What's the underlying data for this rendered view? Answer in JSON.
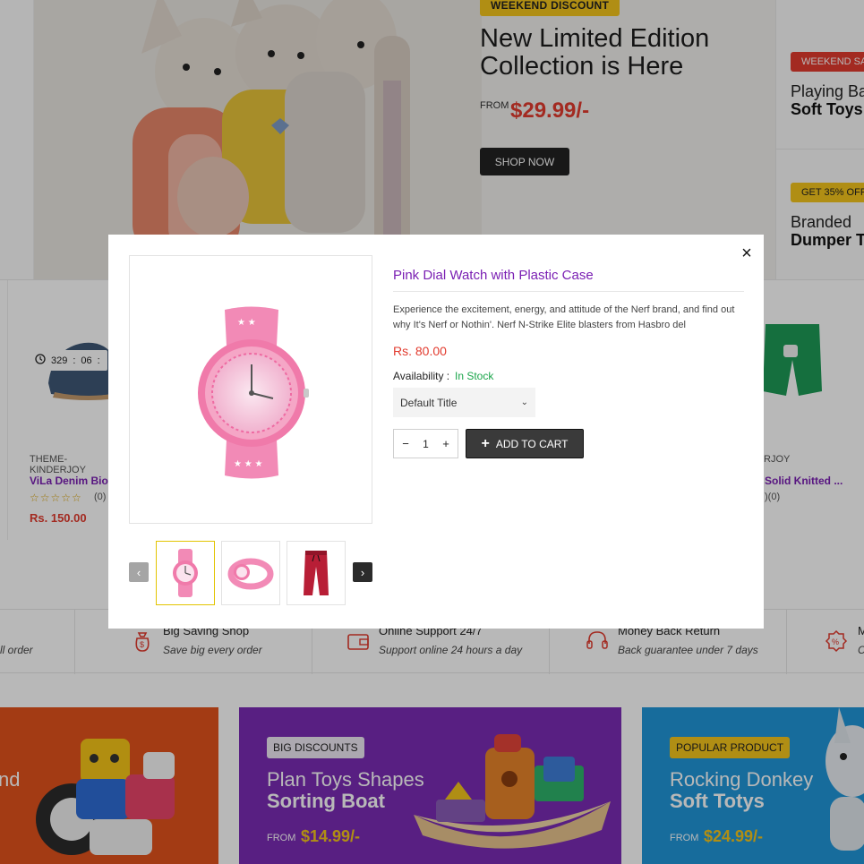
{
  "hero": {
    "badge": "WEEKEND DISCOUNT",
    "title": "New Limited Edition Collection is Here",
    "from_label": "FROM",
    "price": "$29.99/-",
    "button": "SHOP NOW"
  },
  "side_banners": [
    {
      "badge": "WEEKEND SA",
      "line1": "Playing Ba",
      "line2": "Soft Toys"
    },
    {
      "badge": "GET 35% OFF",
      "line1": "Branded",
      "line2": "Dumper Tr"
    }
  ],
  "products": {
    "left": {
      "timer": [
        "329",
        ":",
        "06",
        ":"
      ],
      "vendor": "THEME-KINDERJOY",
      "title": "ViLa Denim Bio Co",
      "stars": "☆☆☆☆☆",
      "count": "(0)",
      "price": "Rs. 150.00"
    },
    "right": {
      "vendor": "RJOY",
      "title": "Solid Knitted ...",
      "count": ")(0)"
    }
  },
  "features": [
    {
      "title": "",
      "subtitle": "ll order"
    },
    {
      "title": "Big Saving Shop",
      "subtitle": "Save big every order"
    },
    {
      "title": "Online Support 24/7",
      "subtitle": "Support online 24 hours a day"
    },
    {
      "title": "Money Back Return",
      "subtitle": "Back guarantee under 7 days"
    },
    {
      "title": "M",
      "subtitle": "C"
    }
  ],
  "promos": [
    {
      "badge": "",
      "line1": "nd",
      "line2": "",
      "from_label": "",
      "price": ""
    },
    {
      "badge": "BIG DISCOUNTS",
      "line1": "Plan Toys Shapes",
      "line2": "Sorting Boat",
      "from_label": "FROM",
      "price": "$14.99/-"
    },
    {
      "badge": "POPULAR PRODUCT",
      "line1": "Rocking Donkey",
      "line2": "Soft Totys",
      "from_label": "FROM",
      "price": "$24.99/-"
    }
  ],
  "modal": {
    "close": "×",
    "title": "Pink Dial Watch with Plastic Case",
    "description": "Experience the excitement, energy, and attitude of the Nerf brand, and find out why It's Nerf or Nothin'. Nerf N-Strike Elite blasters from Hasbro del",
    "price": "Rs. 80.00",
    "availability_label": "Availability :",
    "availability_value": "In Stock",
    "variant_selected": "Default Title",
    "quantity": "1",
    "qty_minus": "−",
    "qty_plus": "+",
    "add_to_cart": "ADD TO CART",
    "add_icon": "+",
    "thumb_prev": "‹",
    "thumb_next": "›"
  },
  "colors": {
    "accent_purple": "#7a1fb3",
    "price_red": "#e23b2e",
    "stock_green": "#1aa54a",
    "badge_yellow": "#f4c51c"
  }
}
